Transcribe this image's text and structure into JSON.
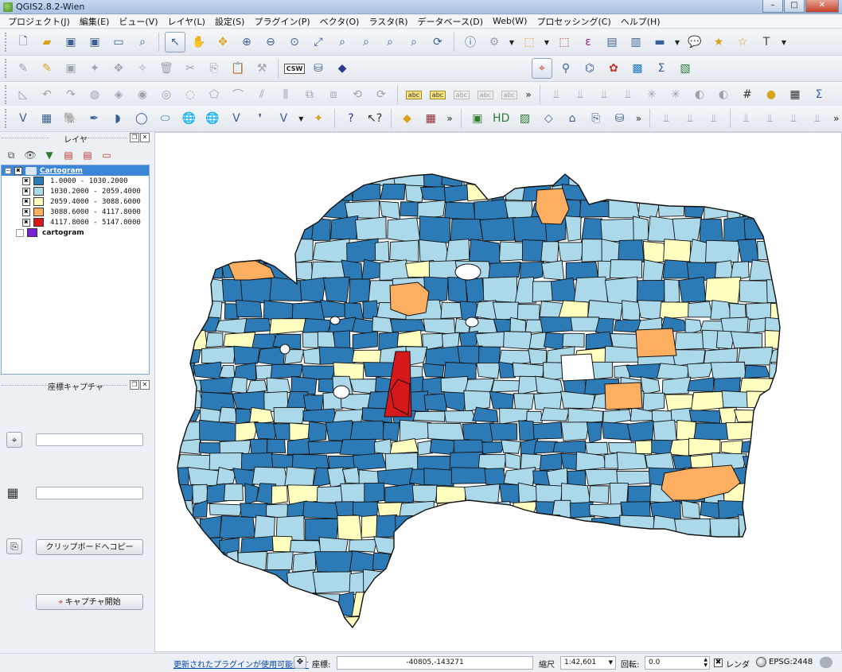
{
  "window": {
    "title": "QGIS2.8.2-Wien",
    "controls": {
      "minimize": "–",
      "maximize": "□",
      "close": "✕"
    }
  },
  "menu": [
    "プロジェクト(J)",
    "編集(E)",
    "ビュー(V)",
    "レイヤ(L)",
    "設定(S)",
    "プラグイン(P)",
    "ベクタ(O)",
    "ラスタ(R)",
    "データベース(D)",
    "Web(W)",
    "プロセッシング(C)",
    "ヘルプ(H)"
  ],
  "toolbar_labels": {
    "csw": "CSW",
    "abc": "abc"
  },
  "layers_panel": {
    "title": "レイヤ",
    "group": {
      "name": "Cartogram",
      "checked": true,
      "classes": [
        {
          "label": "1.0000 - 1030.2000",
          "color": "#2c7bb6",
          "checked": true
        },
        {
          "label": "1030.2000 - 2059.4000",
          "color": "#abd9e9",
          "checked": true
        },
        {
          "label": "2059.4000 - 3088.6000",
          "color": "#ffffbf",
          "checked": true
        },
        {
          "label": "3088.6000 - 4117.8000",
          "color": "#fdae61",
          "checked": true
        },
        {
          "label": "4117.8000 - 5147.0000",
          "color": "#d7191c",
          "checked": true
        }
      ]
    },
    "other_layer": {
      "name": "cartogram",
      "color": "#7a1fd6",
      "checked": false
    }
  },
  "coord_capture": {
    "title": "座標キャプチャ",
    "field1_value": "",
    "field2_value": "",
    "copy_button": "クリップボードへコピー",
    "start_button": "キャプチャ開始"
  },
  "colors": {
    "class1": "#2c7bb6",
    "class2": "#abd9e9",
    "class3": "#ffffbf",
    "class4": "#fdae61",
    "class5": "#d7191c"
  },
  "statusbar": {
    "plugin_update_link": "更新されたプラグインが使用可能です",
    "coord_label": "座標:",
    "coord_value": "-40805,-143271",
    "scale_label": "縮尺",
    "scale_value": "1:42,601",
    "rotation_label": "回転:",
    "rotation_value": "0.0",
    "render_label": "レンダ",
    "render_checked": true,
    "crs": "EPSG:2448"
  }
}
